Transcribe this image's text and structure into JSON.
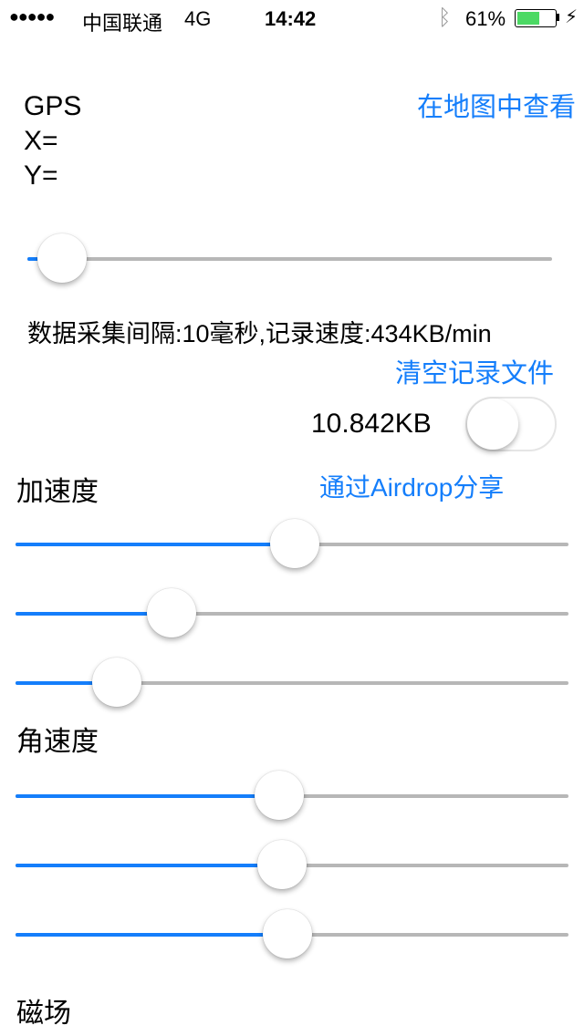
{
  "status": {
    "signal": "●●●●●",
    "carrier": "中国联通",
    "network": "4G",
    "time": "14:42",
    "battery": "61%",
    "battery_level": 0.61,
    "bluetooth_icon": "bluetooth-icon",
    "charging_icon": "bolt-icon"
  },
  "gps": {
    "title": "GPS",
    "x": "X=",
    "y": "Y=",
    "map_link": "在地图中查看",
    "slider": 0.02
  },
  "info": "数据采集间隔:10毫秒,记录速度:434KB/min",
  "clear_button": "清空记录文件",
  "file_size": "10.842KB",
  "toggle_on": false,
  "airdrop_button": "通过Airdrop分享",
  "accel": {
    "title": "加速度",
    "sliders": [
      0.505,
      0.26,
      0.15
    ]
  },
  "gyro": {
    "title": "角速度",
    "sliders": [
      0.475,
      0.48,
      0.49
    ]
  },
  "mag": {
    "title": "磁场"
  },
  "accent": "#147efb"
}
